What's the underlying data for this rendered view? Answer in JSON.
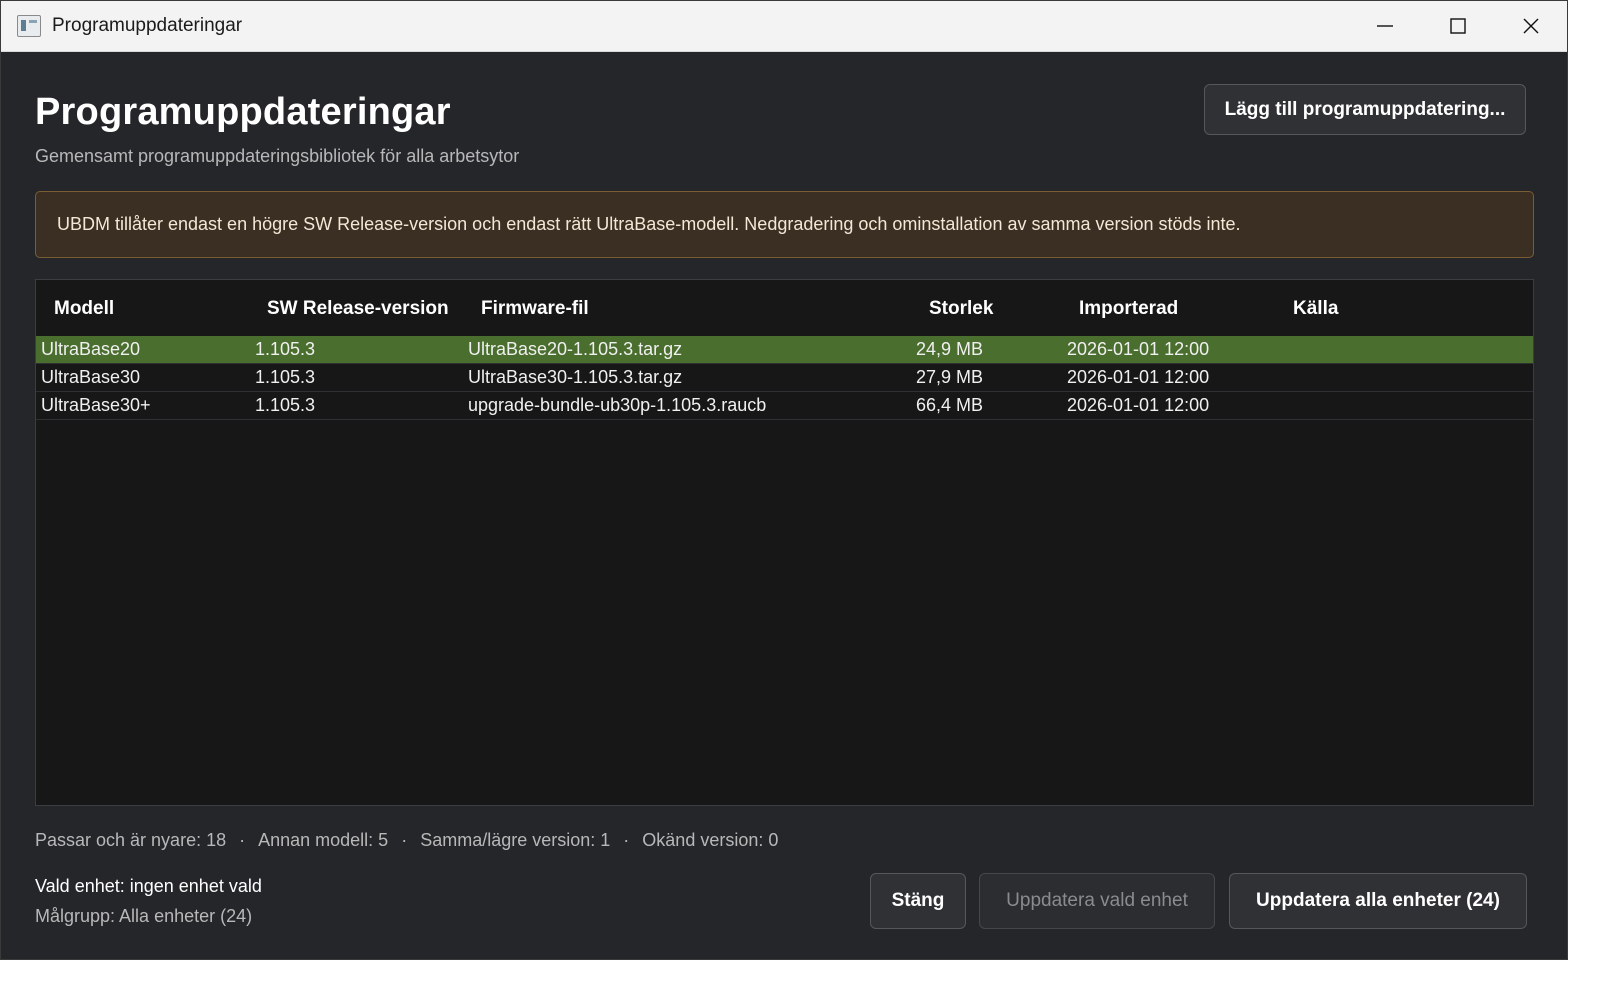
{
  "window": {
    "title": "Programuppdateringar",
    "controls": {
      "minimize_icon": "minimize-icon",
      "maximize_icon": "maximize-icon",
      "close_icon": "close-icon"
    }
  },
  "header": {
    "title": "Programuppdateringar",
    "subtitle": "Gemensamt programuppdateringsbibliotek för alla arbetsytor",
    "add_button": "Lägg till programuppdatering..."
  },
  "warning": {
    "text": "UBDM tillåter endast en högre SW Release-version och endast rätt UltraBase-modell. Nedgradering och ominstallation av samma version stöds inte."
  },
  "table": {
    "columns": [
      "Modell",
      "SW Release-version",
      "Firmware-fil",
      "Storlek",
      "Importerad",
      "Källa"
    ],
    "rows": [
      {
        "model": "UltraBase20",
        "version": "1.105.3",
        "file": "UltraBase20-1.105.3.tar.gz",
        "size": "24,9 MB",
        "imported": "2026-01-01 12:00",
        "source": "",
        "selected": true
      },
      {
        "model": "UltraBase30",
        "version": "1.105.3",
        "file": "UltraBase30-1.105.3.tar.gz",
        "size": "27,9 MB",
        "imported": "2026-01-01 12:00",
        "source": "",
        "selected": false
      },
      {
        "model": "UltraBase30+",
        "version": "1.105.3",
        "file": "upgrade-bundle-ub30p-1.105.3.raucb",
        "size": "66,4 MB",
        "imported": "2026-01-01 12:00",
        "source": "",
        "selected": false
      }
    ]
  },
  "stats": {
    "newer": "Passar och är nyare: 18",
    "other_model": "Annan modell: 5",
    "same_lower": "Samma/lägre version: 1",
    "unknown": "Okänd version: 0",
    "separator": "·"
  },
  "footer": {
    "selected_device": "Vald enhet: ingen enhet vald",
    "target_group": "Målgrupp: Alla enheter (24)",
    "close_button": "Stäng",
    "update_selected_button": "Uppdatera vald enhet",
    "update_all_button": "Uppdatera alla enheter (24)"
  },
  "colors": {
    "background": "#24262a",
    "selected_row": "#4a6e2e",
    "warning_border": "#7a5d33",
    "warning_background": "#3a2f22"
  }
}
